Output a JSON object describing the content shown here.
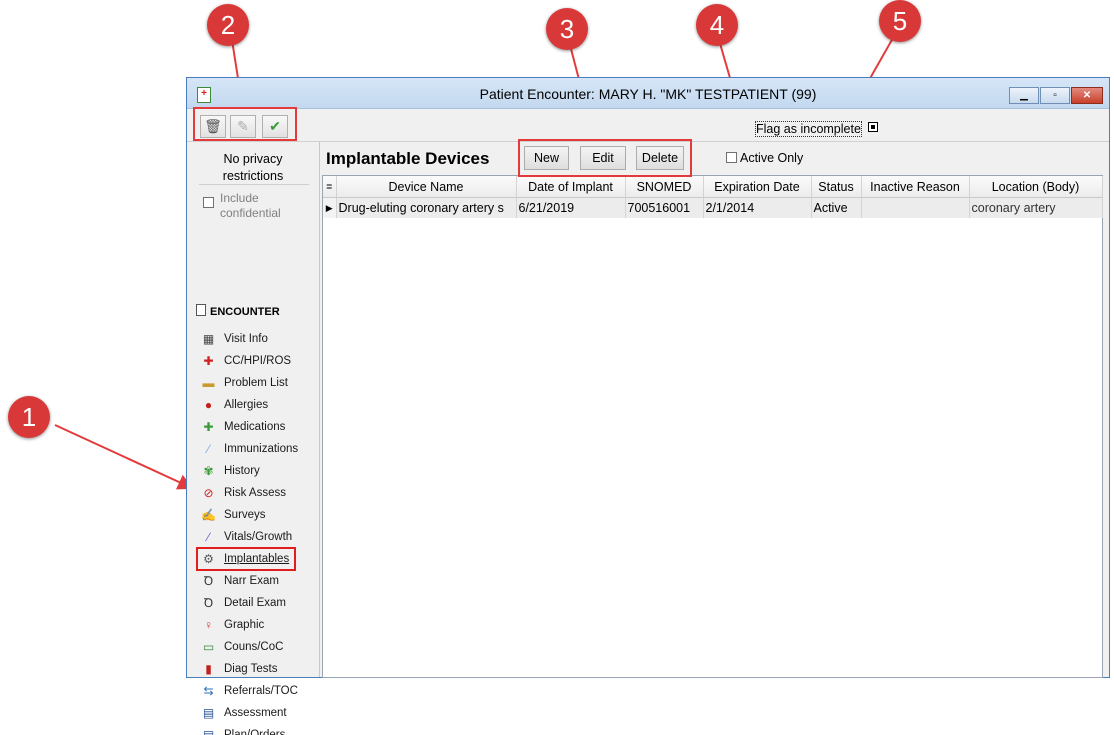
{
  "window": {
    "title": "Patient Encounter: MARY H. \"MK\" TESTPATIENT (99)",
    "controls": {
      "minimize": "▁",
      "maximize": "▫",
      "close": "✕"
    }
  },
  "toolbar": {
    "buttons": [
      {
        "name": "delete",
        "icon": "trash-icon",
        "glyph": "🗑"
      },
      {
        "name": "edit",
        "icon": "pencil-icon",
        "glyph": "✎"
      },
      {
        "name": "sign",
        "icon": "check-icon",
        "glyph": "✔"
      }
    ],
    "flag_label": "Flag as incomplete"
  },
  "sidebar": {
    "privacy": "No privacy restrictions",
    "include_confidential": "Include confidential",
    "section_header": "ENCOUNTER",
    "items": [
      {
        "label": "Visit Info",
        "icon": "visit-info-icon",
        "glyph": "▦"
      },
      {
        "label": "CC/HPI/ROS",
        "icon": "clipboard-icon",
        "glyph": "✚"
      },
      {
        "label": "Problem List",
        "icon": "problem-list-icon",
        "glyph": "▬"
      },
      {
        "label": "Allergies",
        "icon": "allergy-icon",
        "glyph": "●"
      },
      {
        "label": "Medications",
        "icon": "medications-icon",
        "glyph": "✚"
      },
      {
        "label": "Immunizations",
        "icon": "syringe-icon",
        "glyph": "⁄"
      },
      {
        "label": "History",
        "icon": "family-tree-icon",
        "glyph": "✾"
      },
      {
        "label": "Risk Assess",
        "icon": "no-smoking-icon",
        "glyph": "⊘"
      },
      {
        "label": "Surveys",
        "icon": "survey-icon",
        "glyph": "✍"
      },
      {
        "label": "Vitals/Growth",
        "icon": "ruler-icon",
        "glyph": "⁄"
      },
      {
        "label": "Implantables",
        "icon": "chip-icon",
        "glyph": "⚙"
      },
      {
        "label": "Narr Exam",
        "icon": "stethoscope-icon",
        "glyph": "Ꝺ"
      },
      {
        "label": "Detail Exam",
        "icon": "stethoscope-icon",
        "glyph": "Ꝺ"
      },
      {
        "label": "Graphic",
        "icon": "body-figure-icon",
        "glyph": "♀"
      },
      {
        "label": "Couns/CoC",
        "icon": "counseling-icon",
        "glyph": "▭"
      },
      {
        "label": "Diag Tests",
        "icon": "test-tubes-icon",
        "glyph": "▮"
      },
      {
        "label": "Referrals/TOC",
        "icon": "referral-icon",
        "glyph": "⇆"
      },
      {
        "label": "Assessment",
        "icon": "assessment-icon",
        "glyph": "▤"
      },
      {
        "label": "Plan/Orders",
        "icon": "plan-icon",
        "glyph": "▤"
      }
    ]
  },
  "main": {
    "title": "Implantable Devices",
    "buttons": {
      "new": "New",
      "edit": "Edit",
      "delete": "Delete"
    },
    "active_only": "Active Only",
    "columns": [
      "Device Name",
      "Date of Implant",
      "SNOMED",
      "Expiration Date",
      "Status",
      "Inactive Reason",
      "Location (Body)"
    ],
    "rows": [
      [
        "Drug-eluting coronary artery s",
        "6/21/2019",
        "700516001",
        "2/1/2014",
        "Active",
        "",
        "coronary artery"
      ]
    ]
  },
  "annotations": [
    "1",
    "2",
    "3",
    "4",
    "5"
  ],
  "colors": {
    "annotation": "#d93838",
    "highlight": "#e33b3b",
    "window_border": "#4a7dbd"
  }
}
